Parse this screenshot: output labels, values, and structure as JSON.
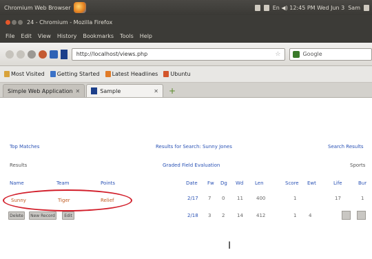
{
  "panel": {
    "app_name": "Chromium Web Browser",
    "tray_text": "En  ◀)  12:45 PM  Wed Jun 3",
    "user": "Sam"
  },
  "window": {
    "title": "24 - Chromium - Mozilla Firefox"
  },
  "menu": [
    "File",
    "Edit",
    "View",
    "History",
    "Bookmarks",
    "Tools",
    "Help"
  ],
  "nav": {
    "url": "http://localhost/views.php",
    "search_placeholder": "Google"
  },
  "bookmarks": [
    {
      "label": "Most Visited",
      "color": "#d8a23a"
    },
    {
      "label": "Getting Started",
      "color": "#3b72c7"
    },
    {
      "label": "Latest Headlines",
      "color": "#e07a26"
    },
    {
      "label": "Ubuntu",
      "color": "#d3552b"
    }
  ],
  "tabs": [
    {
      "label": "Simple Web Application",
      "active": false
    },
    {
      "label": "Sample",
      "active": true
    }
  ],
  "page": {
    "top_left_link": "Top Matches",
    "top_center_text": "Results for Search: Sunny Jones",
    "top_right_link": "Search Results",
    "subheader_left": "Results",
    "subheader_center": "Graded Field Evaluation",
    "subheader_right": "Sports",
    "left_headers": [
      "Name",
      "Team",
      "Points"
    ],
    "left_row": [
      "Sunny",
      "Tiger",
      "Relief"
    ],
    "left_buttons": [
      "Delete",
      "New Record",
      "Edit"
    ],
    "right_headers": [
      "Date",
      "Fw",
      "Dg",
      "Wd",
      "Len",
      "Score",
      "Ewt",
      "Life",
      "Bur"
    ],
    "right_rows": [
      [
        "2/17",
        "7",
        "0",
        "11",
        "400",
        "1",
        "",
        "17",
        "1"
      ],
      [
        "2/18",
        "3",
        "2",
        "14",
        "412",
        "1",
        "4",
        "",
        ""
      ]
    ]
  }
}
